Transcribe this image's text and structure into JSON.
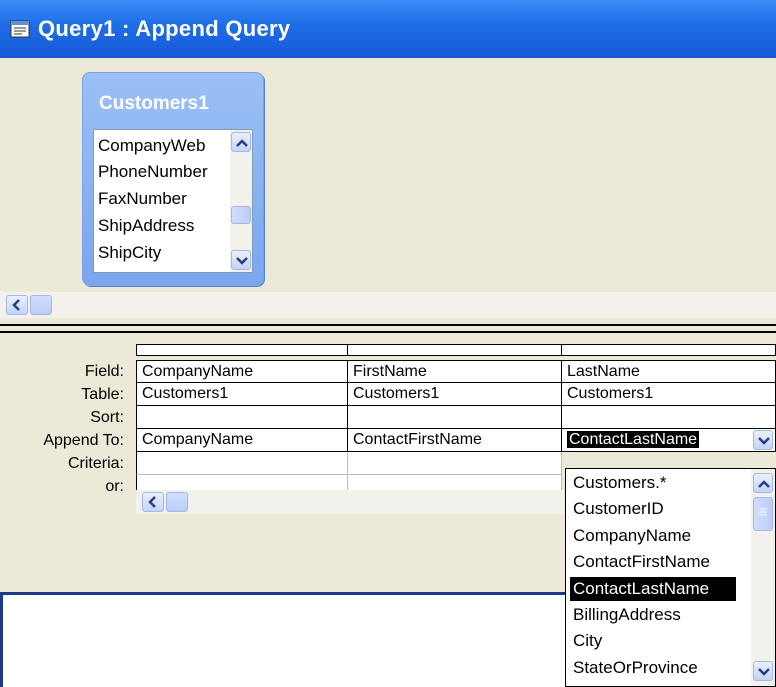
{
  "window": {
    "title": "Query1 : Append Query",
    "icon": "query-icon"
  },
  "table_box": {
    "title": "Customers1",
    "fields": [
      "CompanyWeb",
      "PhoneNumber",
      "FaxNumber",
      "ShipAddress",
      "ShipCity"
    ]
  },
  "grid": {
    "row_labels": [
      "Field:",
      "Table:",
      "Sort:",
      "Append To:",
      "Criteria:",
      "or:"
    ],
    "columns": [
      {
        "field": "CompanyName",
        "table": "Customers1",
        "sort": "",
        "append_to": "CompanyName"
      },
      {
        "field": "FirstName",
        "table": "Customers1",
        "sort": "",
        "append_to": "ContactFirstName"
      },
      {
        "field": "LastName",
        "table": "Customers1",
        "sort": "",
        "append_to": "ContactLastName"
      }
    ]
  },
  "dropdown": {
    "selected": "ContactLastName",
    "options": [
      "Customers.*",
      "CustomerID",
      "CompanyName",
      "ContactFirstName",
      "ContactLastName",
      "BillingAddress",
      "City",
      "StateOrProvince"
    ]
  },
  "colors": {
    "titlebar": "#1f6fe8",
    "pane_bg": "#ece9d8",
    "table_box": "#7aa6ee",
    "selection": "#000000"
  }
}
